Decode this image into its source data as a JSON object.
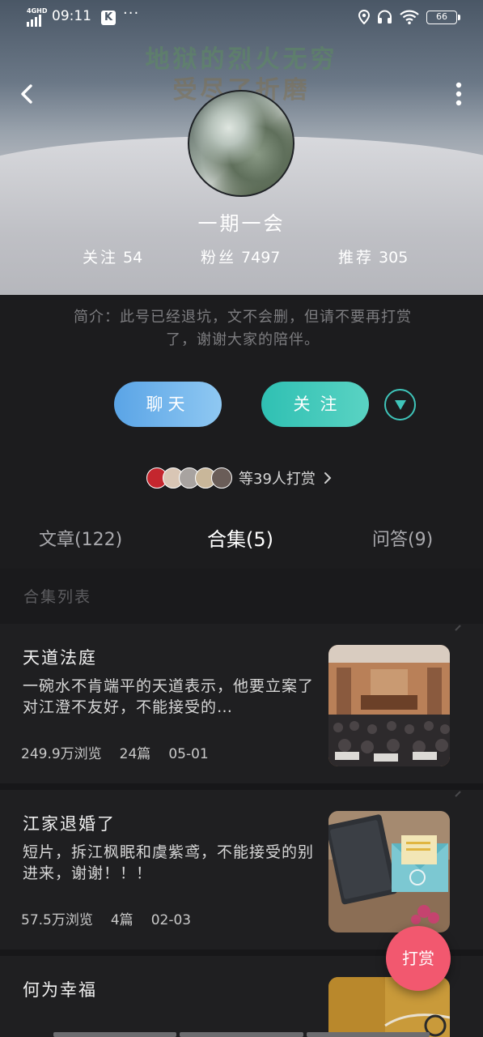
{
  "status_bar": {
    "network": "4GHD",
    "time": "09:11",
    "app_badge": "K",
    "more": "···",
    "battery": "66",
    "icons": [
      "location-icon",
      "headset-icon",
      "wifi-icon",
      "battery-icon"
    ]
  },
  "header": {
    "background_text_line1": "地狱的烈火无穷",
    "background_text_line2": "受尽了折磨",
    "back_icon": "chevron-left-icon",
    "more_icon": "vertical-dots-icon"
  },
  "profile": {
    "nickname": "一期一会",
    "following_label": "关注",
    "following_count": "54",
    "fans_label": "粉丝",
    "fans_count": "7497",
    "recommend_label": "推荐",
    "recommend_count": "305",
    "bio_line1": "简介：此号已经退坑，文不会删，但请不要再打赏",
    "bio_line2": "了，谢谢大家的陪伴。"
  },
  "actions": {
    "chat_label": "聊天",
    "follow_label": "关注",
    "dropdown_icon": "triangle-down-icon",
    "chat_color": "#5aa4e6",
    "follow_color": "#2fc0b3"
  },
  "rewards": {
    "text": "等39人打赏",
    "avatar_colors": [
      "#c4262e",
      "#d9c6b5",
      "#a8a3a0",
      "#c9b79a",
      "#6a5d58"
    ]
  },
  "tabs": [
    {
      "label": "文章(122)",
      "active": false
    },
    {
      "label": "合集(5)",
      "active": true
    },
    {
      "label": "问答(9)",
      "active": false
    }
  ],
  "section_label": "合集列表",
  "collections": [
    {
      "title": "天道法庭",
      "desc": "一碗水不肯端平的天道表示，他要立案了 对江澄不友好，不能接受的…",
      "views": "249.9万浏览",
      "count": "24篇",
      "date": "05-01"
    },
    {
      "title": "江家退婚了",
      "desc": "短片，拆江枫眠和虞紫鸢，不能接受的别进来，谢谢！！！",
      "views": "57.5万浏览",
      "count": "4篇",
      "date": "02-03"
    },
    {
      "title": "何为幸福",
      "desc": "",
      "views": "",
      "count": "",
      "date": ""
    }
  ],
  "fab": {
    "label": "打赏",
    "color": "#f2586f"
  }
}
